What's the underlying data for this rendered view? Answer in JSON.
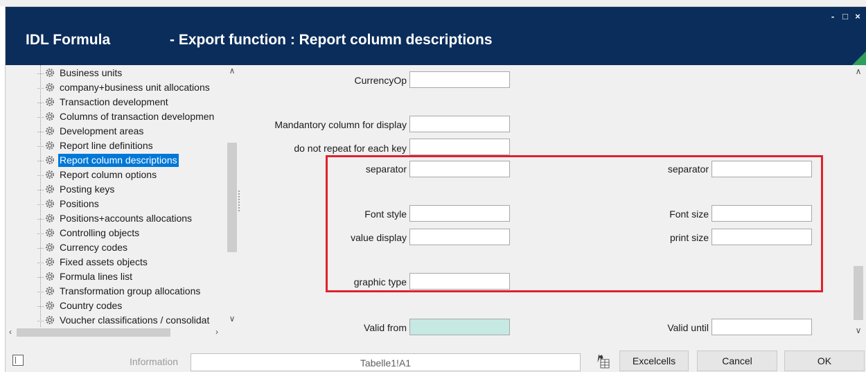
{
  "window": {
    "app_title": "IDL Formula",
    "title": "- Export function : Report column descriptions",
    "controls": {
      "minimize": "-",
      "maximize": "□",
      "close": "×"
    }
  },
  "tree": {
    "items": [
      {
        "label": "Business units",
        "selected": false
      },
      {
        "label": "company+business unit allocations",
        "selected": false
      },
      {
        "label": "Transaction development",
        "selected": false
      },
      {
        "label": "Columns of transaction developmen",
        "selected": false
      },
      {
        "label": "Development areas",
        "selected": false
      },
      {
        "label": "Report line definitions",
        "selected": false
      },
      {
        "label": "Report column descriptions",
        "selected": true
      },
      {
        "label": "Report column options",
        "selected": false
      },
      {
        "label": "Posting keys",
        "selected": false
      },
      {
        "label": "Positions",
        "selected": false
      },
      {
        "label": "Positions+accounts allocations",
        "selected": false
      },
      {
        "label": "Controlling objects",
        "selected": false
      },
      {
        "label": "Currency codes",
        "selected": false
      },
      {
        "label": "Fixed assets objects",
        "selected": false
      },
      {
        "label": "Formula lines list",
        "selected": false
      },
      {
        "label": "Transformation group allocations",
        "selected": false
      },
      {
        "label": "Country codes",
        "selected": false
      },
      {
        "label": "Voucher classifications / consolidat",
        "selected": false
      }
    ],
    "scroll_icons": {
      "up": "chevron-up-icon",
      "down": "chevron-down-icon",
      "left": "chevron-left-icon",
      "right": "chevron-right-icon"
    }
  },
  "form": {
    "currency_op": {
      "label": "CurrencyOp",
      "value": ""
    },
    "mandatory_column": {
      "label": "Mandantory column for display",
      "value": ""
    },
    "do_not_repeat": {
      "label": "do not repeat for each key",
      "value": ""
    },
    "separator_left": {
      "label": "separator",
      "value": ""
    },
    "separator_right": {
      "label": "separator",
      "value": ""
    },
    "font_style": {
      "label": "Font style",
      "value": ""
    },
    "font_size": {
      "label": "Font size",
      "value": ""
    },
    "value_display": {
      "label": "value display",
      "value": ""
    },
    "print_size": {
      "label": "print size",
      "value": ""
    },
    "graphic_type": {
      "label": "graphic type",
      "value": ""
    },
    "valid_from": {
      "label": "Valid from",
      "value": ""
    },
    "valid_until": {
      "label": "Valid until",
      "value": ""
    }
  },
  "statusbar": {
    "info_label": "Information",
    "info_value": "Tabelle1!A1",
    "excelcells_label": "Excelcells",
    "cancel_label": "Cancel",
    "ok_label": "OK"
  },
  "colors": {
    "titlebar": "#0b2d5b",
    "accent_green": "#2e9e5b",
    "selection": "#0078d7",
    "highlight_box": "#e0212e",
    "valid_from_bg": "#c6e9e3"
  }
}
